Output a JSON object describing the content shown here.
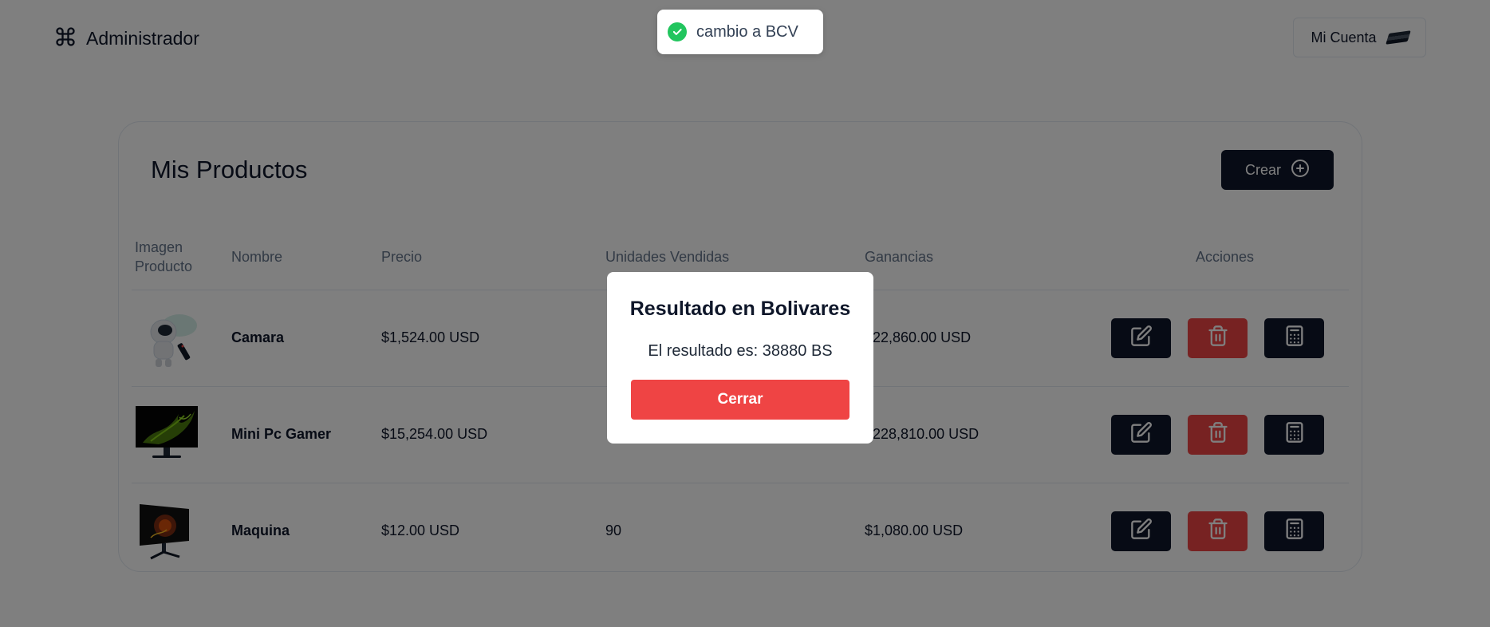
{
  "header": {
    "brand_icon": "command-icon",
    "brand_text": "Administrador",
    "account_label": "Mi Cuenta",
    "account_icon": "flag-icon"
  },
  "card": {
    "title": "Mis Productos",
    "create_label": "Crear",
    "create_icon": "plus-circle-icon"
  },
  "table": {
    "headers": {
      "image": "Imagen Producto",
      "name": "Nombre",
      "price": "Precio",
      "units": "Unidades Vendidas",
      "gains": "Ganancias",
      "actions": "Acciones"
    },
    "rows": [
      {
        "name": "Camara",
        "price": "$1,524.00 USD",
        "units": "",
        "gains": "$22,860.00 USD",
        "image": "astronaut-projector"
      },
      {
        "name": "Mini Pc Gamer",
        "price": "$15,254.00 USD",
        "units": "",
        "gains": "$228,810.00 USD",
        "image": "monitor-green-splash"
      },
      {
        "name": "Maquina",
        "price": "$12.00 USD",
        "units": "90",
        "gains": "$1,080.00 USD",
        "image": "monitor-dark-art"
      }
    ],
    "action_icons": [
      "edit-icon",
      "trash-icon",
      "calculator-icon"
    ]
  },
  "modal": {
    "title": "Resultado en Bolivares",
    "text": "El resultado es: 38880 BS",
    "close_label": "Cerrar"
  },
  "toast": {
    "text": "cambio a BCV",
    "icon": "check-circle-icon"
  },
  "colors": {
    "primary": "#0f172a",
    "danger": "#ef4444",
    "success": "#22c55e",
    "overlay": "rgba(0,0,0,0.5)"
  }
}
